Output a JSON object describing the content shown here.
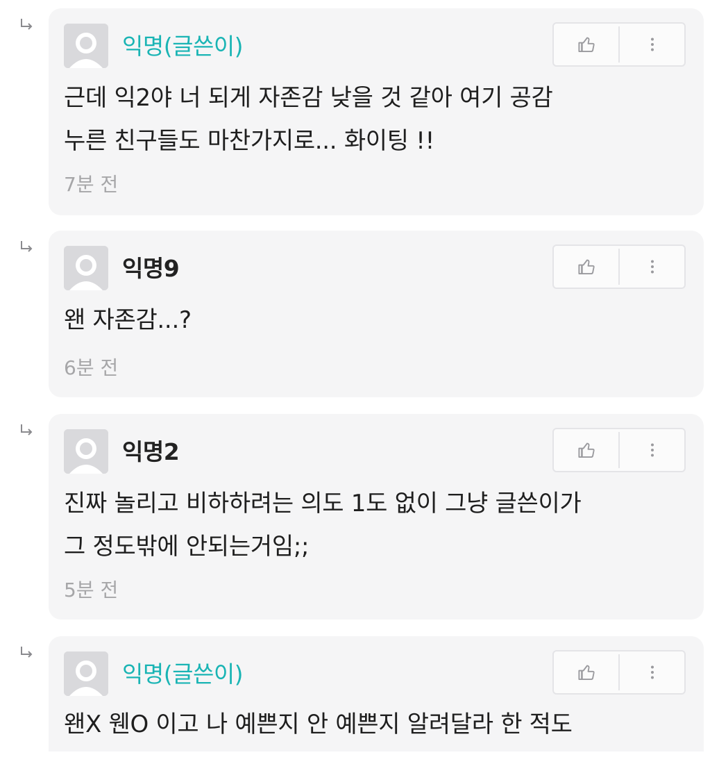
{
  "comments": [
    {
      "author": "익명(글쓴이)",
      "is_author_op": true,
      "body": "근데 익2야 너 되게 자존감 낮을 것 같아 여기 공감\n누른 친구들도 마찬가지로... 화이팅 !!",
      "time": "7분 전"
    },
    {
      "author": "익명9",
      "is_author_op": false,
      "body": "왠 자존감...?",
      "time": "6분 전"
    },
    {
      "author": "익명2",
      "is_author_op": false,
      "body": "진짜 놀리고 비하하려는 의도 1도 없이 그냥 글쓴이가\n그 정도밖에 안되는거임;;",
      "time": "5분 전"
    },
    {
      "author": "익명(글쓴이)",
      "is_author_op": true,
      "body": "왠X 웬O 이고 나 예쁜지 안 예쁜지 알려달라 한 적도",
      "time": ""
    }
  ],
  "icons": {
    "reply": "reply-arrow-icon",
    "like": "thumbs-up-icon",
    "more": "more-vertical-icon",
    "avatar": "default-avatar-icon"
  },
  "colors": {
    "op_author": "#19b4b4",
    "card_bg": "#f5f5f6",
    "timestamp": "#a6a6a8"
  }
}
